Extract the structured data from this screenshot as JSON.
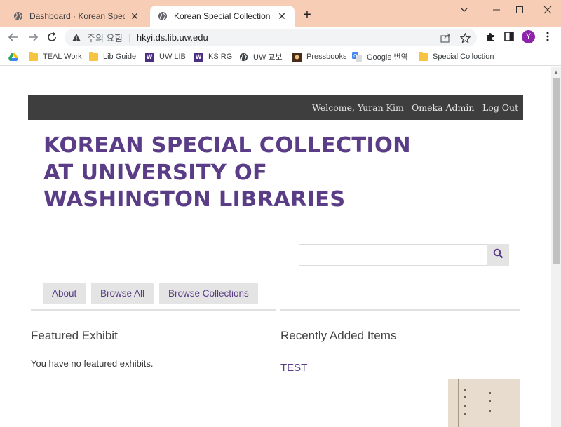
{
  "browser": {
    "tabs": [
      {
        "title": "Dashboard · Korean Special Coll",
        "active": false
      },
      {
        "title": "Korean Special Collection at Un",
        "active": true
      }
    ],
    "address_bar": {
      "security_label": "주의 요함",
      "url": "hkyi.ds.lib.uw.edu"
    },
    "profile_initial": "Y",
    "bookmarks": [
      {
        "label": "",
        "icon": "google-drive-icon"
      },
      {
        "label": "TEAL Work",
        "icon": "folder-icon"
      },
      {
        "label": "Lib Guide",
        "icon": "folder-icon"
      },
      {
        "label": "UW LIB",
        "icon": "uw-logo-icon"
      },
      {
        "label": "KS RG",
        "icon": "uw-logo-icon"
      },
      {
        "label": "UW 교보",
        "icon": "globe-icon"
      },
      {
        "label": "Pressbooks",
        "icon": "pressbooks-icon"
      },
      {
        "label": "Google 번역",
        "icon": "google-translate-icon"
      },
      {
        "label": "Special Colloction",
        "icon": "folder-icon"
      }
    ]
  },
  "page": {
    "topbar": {
      "welcome": "Welcome, Yuran Kim",
      "admin_link": "Omeka Admin",
      "logout_link": "Log Out"
    },
    "site_title": "KOREAN SPECIAL COLLECTION AT UNIVERSITY OF WASHINGTON LIBRARIES",
    "search": {
      "placeholder": ""
    },
    "nav": [
      "About",
      "Browse All",
      "Browse Collections"
    ],
    "featured": {
      "heading": "Featured Exhibit",
      "text": "You have no featured exhibits."
    },
    "recent": {
      "heading": "Recently Added Items",
      "items": [
        {
          "title": "TEST"
        }
      ]
    }
  },
  "colors": {
    "tabstrip": "#f8cdb6",
    "accent_purple": "#5a3d86",
    "topbar": "#3e3e3e"
  }
}
